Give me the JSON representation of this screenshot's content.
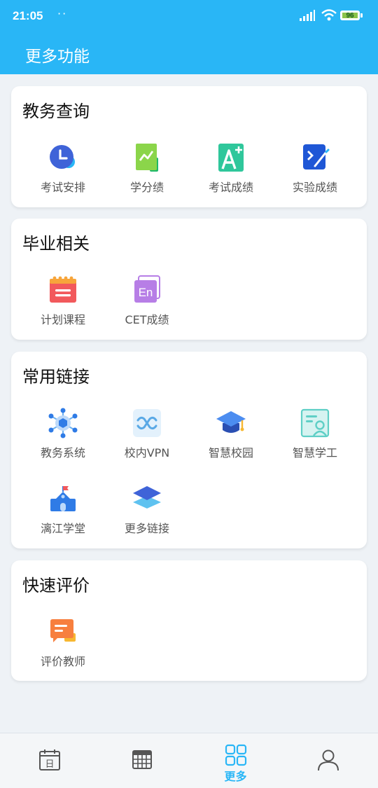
{
  "status": {
    "time": "21:05",
    "dots": "··",
    "battery": "96"
  },
  "header": {
    "title": "更多功能"
  },
  "sections": [
    {
      "title": "教务查询",
      "items": [
        {
          "label": "考试安排",
          "icon": "clock-icon"
        },
        {
          "label": "学分绩",
          "icon": "chart-icon"
        },
        {
          "label": "考试成绩",
          "icon": "grade-a-plus-icon"
        },
        {
          "label": "实验成绩",
          "icon": "experiment-icon"
        }
      ]
    },
    {
      "title": "毕业相关",
      "items": [
        {
          "label": "计划课程",
          "icon": "plan-calendar-icon"
        },
        {
          "label": "CET成绩",
          "icon": "cet-en-icon",
          "icon_text": "En"
        }
      ]
    },
    {
      "title": "常用链接",
      "items": [
        {
          "label": "教务系统",
          "icon": "network-hub-icon"
        },
        {
          "label": "校内VPN",
          "icon": "vpn-link-icon"
        },
        {
          "label": "智慧校园",
          "icon": "graduation-cap-icon"
        },
        {
          "label": "智慧学工",
          "icon": "id-card-icon"
        },
        {
          "label": "漓江学堂",
          "icon": "school-building-icon"
        },
        {
          "label": "更多链接",
          "icon": "layers-icon"
        }
      ]
    },
    {
      "title": "快速评价",
      "items": [
        {
          "label": "评价教师",
          "icon": "comment-icon"
        }
      ]
    }
  ],
  "bottom_nav": [
    {
      "icon": "calendar-day-icon",
      "label": "",
      "day_char": "日"
    },
    {
      "icon": "timetable-icon",
      "label": ""
    },
    {
      "icon": "grid-apps-icon",
      "label": "更多",
      "active": true
    },
    {
      "icon": "user-icon",
      "label": ""
    }
  ],
  "colors": {
    "primary": "#29b6f6",
    "background": "#eef2f6"
  }
}
